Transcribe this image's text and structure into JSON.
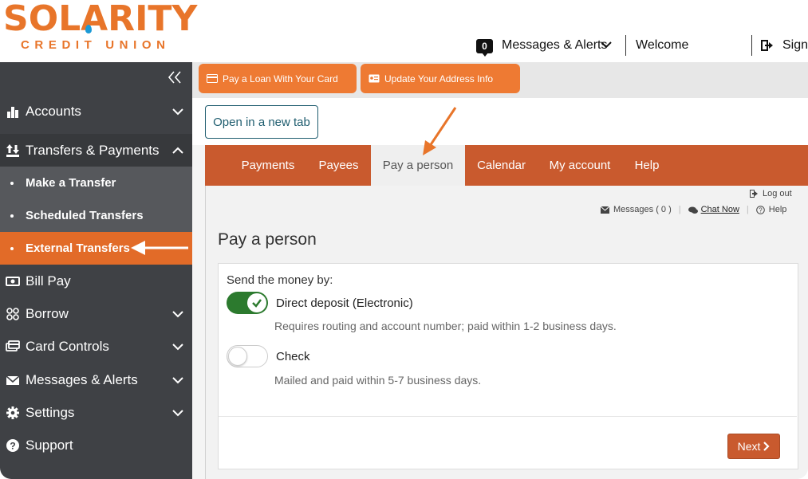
{
  "header": {
    "logo_main": "SOLARITY",
    "logo_sub": "CREDIT UNION",
    "messages_count": "0",
    "messages_label": "Messages & Alerts",
    "welcome": "Welcome",
    "sign_label": "Sign"
  },
  "sidebar": {
    "items": [
      {
        "label": "Accounts",
        "icon": "bar-chart-icon"
      },
      {
        "label": "Transfers & Payments",
        "icon": "transfer-icon"
      },
      {
        "label": "Make a Transfer"
      },
      {
        "label": "Scheduled Transfers"
      },
      {
        "label": "External Transfers"
      },
      {
        "label": "Bill Pay",
        "icon": "bill-icon"
      },
      {
        "label": "Borrow",
        "icon": "borrow-icon"
      },
      {
        "label": "Card Controls",
        "icon": "card-icon"
      },
      {
        "label": "Messages & Alerts",
        "icon": "envelope-icon"
      },
      {
        "label": "Settings",
        "icon": "gear-icon"
      },
      {
        "label": "Support",
        "icon": "question-icon"
      }
    ]
  },
  "promos": {
    "pay_loan": "Pay a Loan With Your Card",
    "update_address": "Update Your Address Info"
  },
  "open_new_tab": "Open in a new tab",
  "tabs": [
    "Payments",
    "Payees",
    "Pay a person",
    "Calendar",
    "My account",
    "Help"
  ],
  "utility": {
    "logout": "Log out",
    "messages": "Messages ( 0 )",
    "chat": "Chat Now",
    "help": "Help"
  },
  "main": {
    "title": "Pay a person",
    "send_by": "Send the money by:",
    "options": [
      {
        "label": "Direct deposit (Electronic)",
        "desc": "Requires routing and account number; paid within 1-2 business days.",
        "enabled": true
      },
      {
        "label": "Check",
        "desc": "Mailed and paid within 5-7 business days.",
        "enabled": false
      }
    ],
    "next": "Next"
  },
  "colors": {
    "brand_orange": "#e8752a",
    "tab_bar": "#c95a2e",
    "sidebar": "#3f4145",
    "toggle_on": "#2c7a2e",
    "link_teal": "#1f5d6f"
  }
}
